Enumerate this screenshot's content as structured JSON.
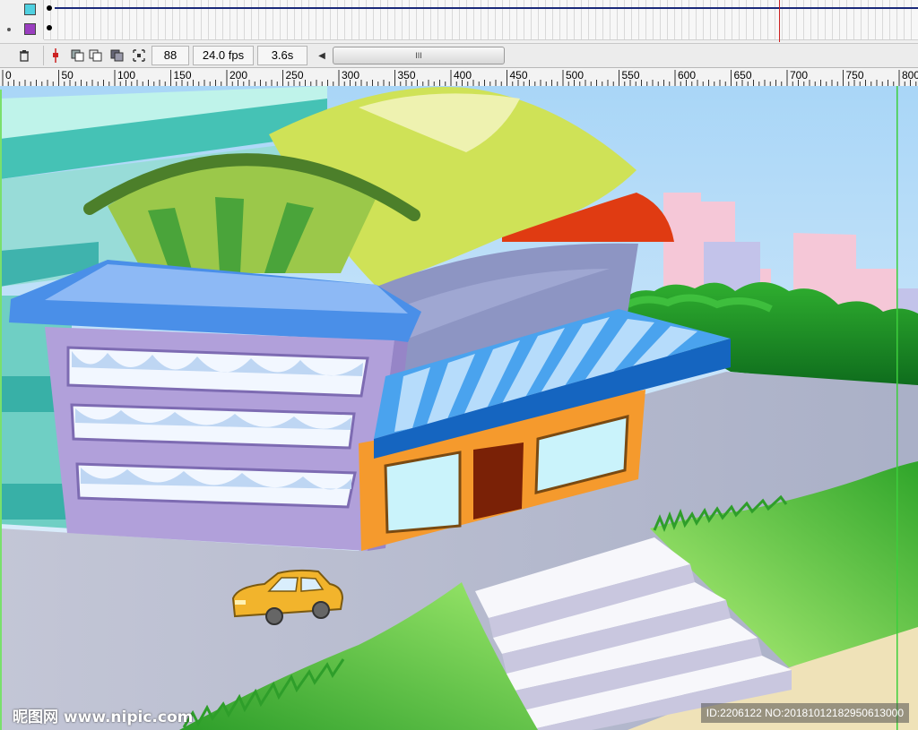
{
  "timeline": {
    "layers": [
      {
        "name_color": "#4fd0e0"
      },
      {
        "name_color": "#9a3ec0"
      }
    ],
    "current_frame": "88",
    "frame_rate": "24.0 fps",
    "elapsed_time": "3.6s",
    "scrollbar_grip": "III"
  },
  "ruler": {
    "labels": [
      "0",
      "50",
      "100",
      "150",
      "200",
      "250",
      "300",
      "350",
      "400",
      "450",
      "500",
      "550",
      "600",
      "650",
      "700",
      "750",
      "800"
    ]
  },
  "watermark": {
    "left": "昵图网 www.nipic.com",
    "right": "ID:2206122 NO:20181012182950613000"
  },
  "colors": {
    "sky": "#d7ecfb",
    "ground": "#aeb4c9",
    "building_purple": "#b7a3dc",
    "awning_blue": "#4aa3ee",
    "shop_orange": "#f59a2d",
    "grass_green": "#43b832",
    "car_yellow": "#f2b42c"
  }
}
